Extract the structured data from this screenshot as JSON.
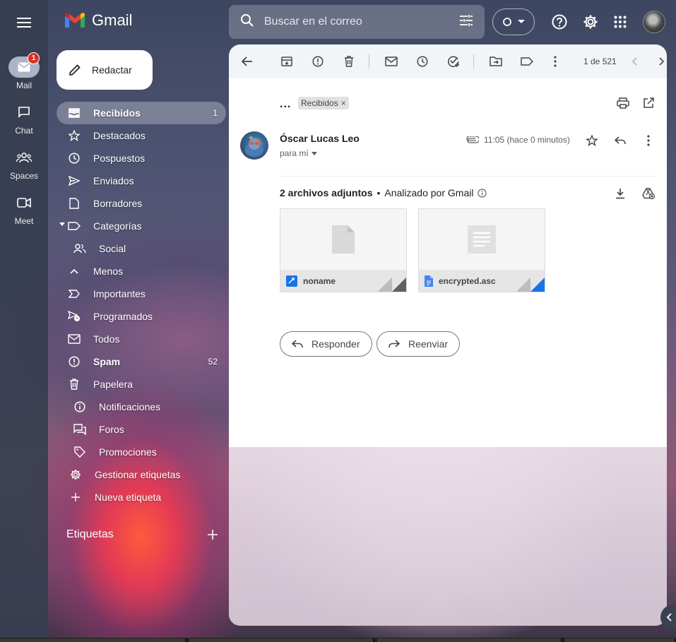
{
  "app": {
    "name": "Gmail"
  },
  "rail": {
    "items": [
      {
        "label": "Mail",
        "icon": "mail-icon",
        "badge": "1"
      },
      {
        "label": "Chat",
        "icon": "chat-icon"
      },
      {
        "label": "Spaces",
        "icon": "spaces-icon"
      },
      {
        "label": "Meet",
        "icon": "meet-icon"
      }
    ]
  },
  "search": {
    "placeholder": "Buscar en el correo"
  },
  "compose": {
    "label": "Redactar"
  },
  "nav": {
    "items": [
      {
        "label": "Recibidos",
        "count": "1"
      },
      {
        "label": "Destacados"
      },
      {
        "label": "Pospuestos"
      },
      {
        "label": "Enviados"
      },
      {
        "label": "Borradores"
      },
      {
        "label": "Categorías"
      },
      {
        "label": "Social"
      },
      {
        "label": "Menos"
      },
      {
        "label": "Importantes"
      },
      {
        "label": "Programados"
      },
      {
        "label": "Todos"
      },
      {
        "label": "Spam",
        "count": "52"
      },
      {
        "label": "Papelera"
      },
      {
        "label": "Notificaciones"
      },
      {
        "label": "Foros"
      },
      {
        "label": "Promociones"
      },
      {
        "label": "Gestionar etiquetas"
      },
      {
        "label": "Nueva etiqueta"
      }
    ],
    "labels_heading": "Etiquetas"
  },
  "toolbar": {
    "pager": "1 de 521"
  },
  "message": {
    "ellipsis": "...",
    "label_tag": "Recibidos",
    "sender": "Óscar Lucas Leo",
    "to": "para mí",
    "time": "11:05 (hace 0 minutos)",
    "attachments_title": "2 archivos adjuntos",
    "attachments_scan": "Analizado por Gmail",
    "attachments": [
      {
        "name": "noname"
      },
      {
        "name": "encrypted.asc"
      }
    ],
    "reply_label": "Responder",
    "forward_label": "Reenviar"
  },
  "colors": {
    "accent_blue": "#1a73e8",
    "badge_red": "#d93025"
  }
}
